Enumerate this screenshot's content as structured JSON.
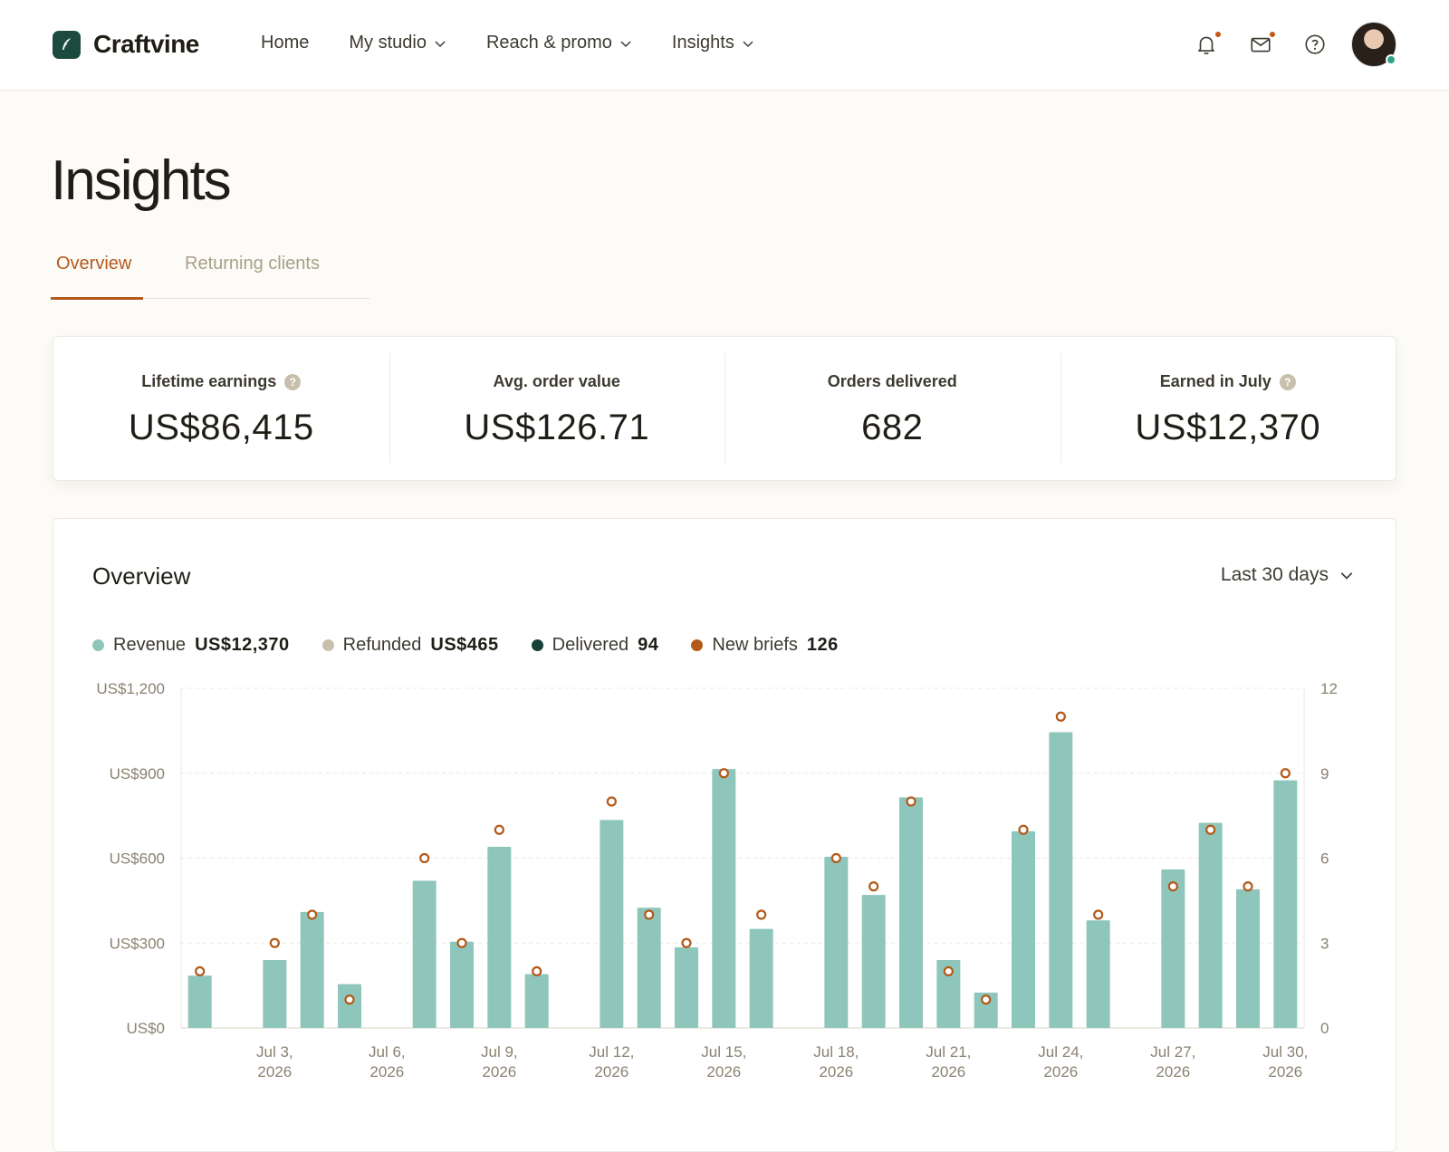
{
  "brand": {
    "name": "Craftvine",
    "logo_icon": "feather-icon",
    "color": "#1d4a3e"
  },
  "nav": {
    "items": [
      {
        "label": "Home",
        "has_dropdown": false
      },
      {
        "label": "My studio",
        "has_dropdown": true
      },
      {
        "label": "Reach & promo",
        "has_dropdown": true
      },
      {
        "label": "Insights",
        "has_dropdown": true
      }
    ]
  },
  "header_icons": {
    "notifications": {
      "icon": "bell-icon",
      "has_badge": true
    },
    "messages": {
      "icon": "envelope-icon",
      "has_badge": true
    },
    "help": {
      "icon": "question-circle-icon"
    },
    "avatar": {
      "status": "online"
    },
    "badge_color": "#c05a12"
  },
  "page": {
    "title": "Insights"
  },
  "tabs": [
    {
      "label": "Overview",
      "active": true
    },
    {
      "label": "Returning clients",
      "active": false
    }
  ],
  "stats": [
    {
      "label": "Lifetime earnings",
      "value": "US$86,415",
      "has_help": true
    },
    {
      "label": "Avg. order value",
      "value": "US$126.71",
      "has_help": false
    },
    {
      "label": "Orders delivered",
      "value": "682",
      "has_help": false
    },
    {
      "label": "Earned in July",
      "value": "US$12,370",
      "has_help": true
    }
  ],
  "overview": {
    "title": "Overview",
    "range": "Last 30 days",
    "legend": [
      {
        "name": "Revenue",
        "value": "US$12,370",
        "color": "#8fc6bb"
      },
      {
        "name": "Refunded",
        "value": "US$465",
        "color": "#c8c0ad"
      },
      {
        "name": "Delivered",
        "value": "94",
        "color": "#17413a"
      },
      {
        "name": "New briefs",
        "value": "126",
        "color": "#b35a1b"
      }
    ]
  },
  "chart_data": {
    "type": "bar",
    "x": [
      "Jul 1",
      "Jul 2",
      "Jul 3",
      "Jul 4",
      "Jul 5",
      "Jul 6",
      "Jul 7",
      "Jul 8",
      "Jul 9",
      "Jul 10",
      "Jul 11",
      "Jul 12",
      "Jul 13",
      "Jul 14",
      "Jul 15",
      "Jul 16",
      "Jul 17",
      "Jul 18",
      "Jul 19",
      "Jul 20",
      "Jul 21",
      "Jul 22",
      "Jul 23",
      "Jul 24",
      "Jul 25",
      "Jul 26",
      "Jul 27",
      "Jul 28",
      "Jul 29",
      "Jul 30"
    ],
    "x_tick_labels": [
      {
        "index": 2,
        "line1": "Jul 3,",
        "line2": "2026"
      },
      {
        "index": 5,
        "line1": "Jul 6,",
        "line2": "2026"
      },
      {
        "index": 8,
        "line1": "Jul 9,",
        "line2": "2026"
      },
      {
        "index": 11,
        "line1": "Jul 12,",
        "line2": "2026"
      },
      {
        "index": 14,
        "line1": "Jul 15,",
        "line2": "2026"
      },
      {
        "index": 17,
        "line1": "Jul 18,",
        "line2": "2026"
      },
      {
        "index": 20,
        "line1": "Jul 21,",
        "line2": "2026"
      },
      {
        "index": 23,
        "line1": "Jul 24,",
        "line2": "2026"
      },
      {
        "index": 26,
        "line1": "Jul 27,",
        "line2": "2026"
      },
      {
        "index": 29,
        "line1": "Jul 30,",
        "line2": "2026"
      }
    ],
    "series": [
      {
        "name": "Revenue",
        "axis": "left",
        "mark": "bar",
        "color": "#8fc6bb",
        "values": [
          185,
          0,
          240,
          410,
          155,
          0,
          520,
          305,
          640,
          190,
          0,
          735,
          425,
          285,
          915,
          350,
          0,
          605,
          470,
          815,
          240,
          125,
          695,
          1045,
          380,
          0,
          560,
          725,
          490,
          875
        ]
      },
      {
        "name": "New briefs",
        "axis": "right",
        "mark": "point",
        "color": "#b35a1b",
        "values": [
          2,
          null,
          3,
          4,
          1,
          null,
          6,
          3,
          7,
          2,
          null,
          8,
          4,
          3,
          9,
          4,
          null,
          6,
          5,
          8,
          2,
          1,
          7,
          11,
          4,
          null,
          5,
          7,
          5,
          9
        ]
      }
    ],
    "y_left": {
      "ticks": [
        "US$0",
        "US$300",
        "US$600",
        "US$900",
        "US$1,200"
      ],
      "range": [
        0,
        1200
      ]
    },
    "y_right": {
      "ticks": [
        "0",
        "3",
        "6",
        "9",
        "12"
      ],
      "range": [
        0,
        12
      ]
    },
    "grid": true,
    "legend_position": "top-left"
  }
}
